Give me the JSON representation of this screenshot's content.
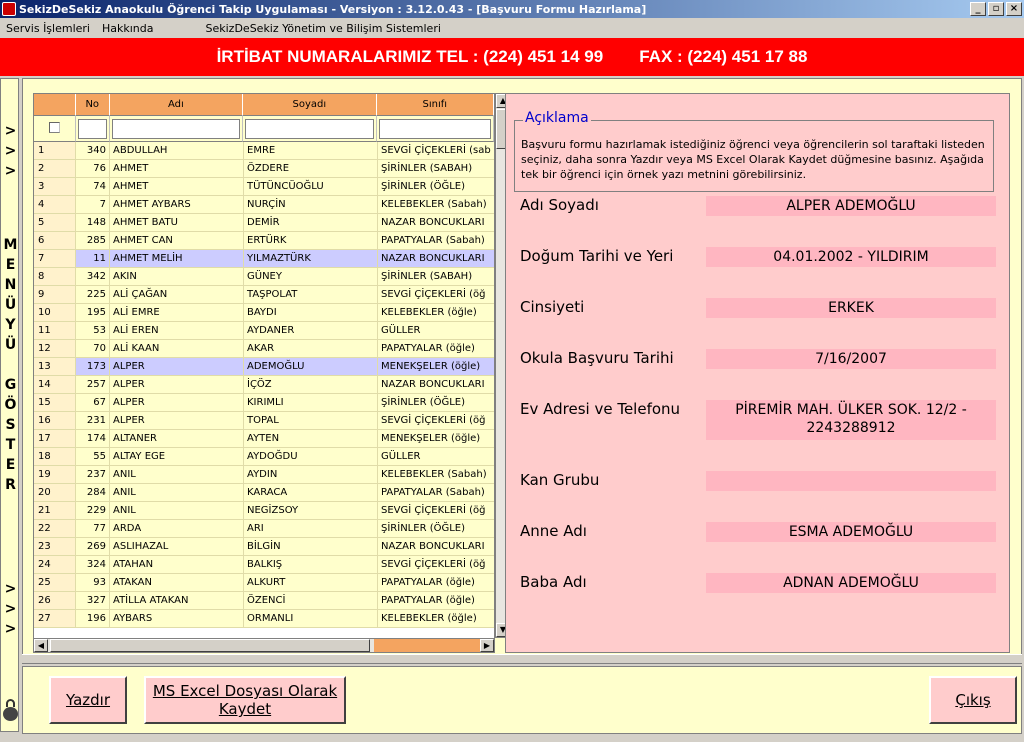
{
  "window": {
    "title": "SekizDeSekiz Anaokulu Öğrenci Takip Uygulaması - Versiyon : 3.12.0.43 - [Başvuru Formu Hazırlama]",
    "buttons": [
      "_",
      "▫",
      "×"
    ]
  },
  "menu": {
    "items": [
      "Servis İşlemleri",
      "Hakkında"
    ],
    "system": "SekizDeSekiz Yönetim ve Bilişim Sistemleri"
  },
  "banner": {
    "tel": "İRTİBAT NUMARALARIMIZ  TEL : (224) 451 14 99",
    "fax": "FAX : (224) 451 17 88"
  },
  "left_menu": {
    "top_arrows": [
      ">",
      ">",
      ">"
    ],
    "letters": [
      "M",
      "E",
      "N",
      "Ü",
      "Y",
      "Ü",
      "",
      "G",
      "Ö",
      "S",
      "T",
      "E",
      "R"
    ],
    "bottom_arrows": [
      ">",
      ">",
      ">"
    ]
  },
  "grid": {
    "columns": [
      "No",
      "Adı",
      "Soyadı",
      "Sınıfı"
    ],
    "rows": [
      [
        "1",
        "340",
        "ABDULLAH",
        "EMRE",
        "SEVGİ ÇİÇEKLERİ (sab"
      ],
      [
        "2",
        "76",
        "AHMET",
        "ÖZDERE",
        "ŞİRİNLER (SABAH)"
      ],
      [
        "3",
        "74",
        "AHMET",
        "TÜTÜNCÜOĞLU",
        "ŞİRİNLER (ÖĞLE)"
      ],
      [
        "4",
        "7",
        "AHMET AYBARS",
        "NURÇİN",
        "KELEBEKLER (Sabah)"
      ],
      [
        "5",
        "148",
        "AHMET BATU",
        "DEMİR",
        "NAZAR BONCUKLARI"
      ],
      [
        "6",
        "285",
        "AHMET CAN",
        "ERTÜRK",
        "PAPATYALAR (Sabah)"
      ],
      [
        "7",
        "11",
        "AHMET MELİH",
        "YILMAZTÜRK",
        "NAZAR BONCUKLARI"
      ],
      [
        "8",
        "342",
        "AKIN",
        "GÜNEY",
        "ŞİRİNLER (SABAH)"
      ],
      [
        "9",
        "225",
        "ALİ ÇAĞAN",
        "TAŞPOLAT",
        "SEVGİ ÇİÇEKLERİ (öğ"
      ],
      [
        "10",
        "195",
        "ALİ EMRE",
        "BAYDI",
        "KELEBEKLER (öğle)"
      ],
      [
        "11",
        "53",
        "ALİ EREN",
        "AYDANER",
        "GÜLLER"
      ],
      [
        "12",
        "70",
        "ALİ KAAN",
        "AKAR",
        "PAPATYALAR (öğle)"
      ],
      [
        "13",
        "173",
        "ALPER",
        "ADEMOĞLU",
        "MENEKŞELER (öğle)"
      ],
      [
        "14",
        "257",
        "ALPER",
        "İÇÖZ",
        "NAZAR BONCUKLARI"
      ],
      [
        "15",
        "67",
        "ALPER",
        "KIRIMLI",
        "ŞİRİNLER (ÖĞLE)"
      ],
      [
        "16",
        "231",
        "ALPER",
        "TOPAL",
        "SEVGİ ÇİÇEKLERİ (öğ"
      ],
      [
        "17",
        "174",
        "ALTANER",
        "AYTEN",
        "MENEKŞELER (öğle)"
      ],
      [
        "18",
        "55",
        "ALTAY EGE",
        "AYDOĞDU",
        "GÜLLER"
      ],
      [
        "19",
        "237",
        "ANIL",
        "AYDIN",
        "KELEBEKLER (Sabah)"
      ],
      [
        "20",
        "284",
        "ANIL",
        "KARACA",
        "PAPATYALAR (Sabah)"
      ],
      [
        "21",
        "229",
        "ANIL",
        "NEGİZSOY",
        "SEVGİ ÇİÇEKLERİ (öğ"
      ],
      [
        "22",
        "77",
        "ARDA",
        "ARI",
        "ŞİRİNLER (ÖĞLE)"
      ],
      [
        "23",
        "269",
        "ASLIHAZAL",
        "BİLGİN",
        "NAZAR BONCUKLARI"
      ],
      [
        "24",
        "324",
        "ATAHAN",
        "BALKIŞ",
        "SEVGİ ÇİÇEKLERİ (öğ"
      ],
      [
        "25",
        "93",
        "ATAKAN",
        "ALKURT",
        "PAPATYALAR (öğle)"
      ],
      [
        "26",
        "327",
        "ATİLLA ATAKAN",
        "ÖZENCİ",
        "PAPATYALAR (öğle)"
      ],
      [
        "27",
        "196",
        "AYBARS",
        "ORMANLI",
        "KELEBEKLER (öğle)"
      ]
    ],
    "selected_rows": [
      7,
      13
    ]
  },
  "info": {
    "aciklama_title": "Açıklama",
    "aciklama_text": "Başvuru formu hazırlamak istediğiniz öğrenci veya öğrencilerin sol taraftaki listeden seçiniz, daha sonra Yazdır veya MS Excel Olarak Kaydet düğmesine basınız. Aşağıda tek bir öğrenci için örnek yazı metnini görebilirsiniz.",
    "fields": [
      {
        "label": "Adı Soyadı",
        "value": "ALPER  ADEMOĞLU"
      },
      {
        "label": "Doğum Tarihi ve Yeri",
        "value": "04.01.2002 - YILDIRIM"
      },
      {
        "label": "Cinsiyeti",
        "value": "ERKEK"
      },
      {
        "label": "Okula Başvuru Tarihi",
        "value": "7/16/2007"
      },
      {
        "label": "Ev Adresi ve Telefonu",
        "value": "PİREMİR MAH. ÜLKER SOK. 12/2 - 2243288912"
      },
      {
        "label": "Kan Grubu",
        "value": ""
      },
      {
        "label": "Anne Adı",
        "value": "ESMA ADEMOĞLU"
      },
      {
        "label": "Baba Adı",
        "value": "ADNAN ADEMOĞLU"
      }
    ]
  },
  "buttons": {
    "print": "Yazdır",
    "excel": "MS Excel Dosyası Olarak Kaydet",
    "exit": "Çıkış"
  },
  "colors": {
    "banner": "#ff0000",
    "panel": "#ffffcc",
    "info": "#ffcccc",
    "header": "#f4a460",
    "selected_row": "#ccccff"
  }
}
